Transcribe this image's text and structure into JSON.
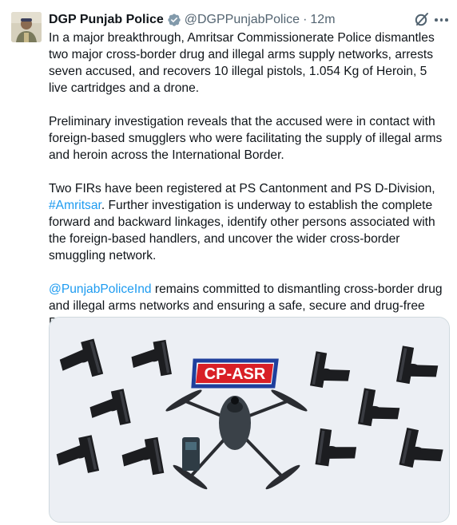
{
  "tweet": {
    "author_name": "DGP Punjab Police",
    "handle": "@DGPPunjabPolice",
    "separator": "·",
    "time": "12m",
    "paragraphs": {
      "p1": "In a major breakthrough, Amritsar Commissionerate Police dismantles two major cross-border drug and illegal arms supply networks, arrests seven accused, and recovers 10 illegal pistols, 1.054 Kg of Heroin, 5 live cartridges and a drone.",
      "p2": "Preliminary investigation reveals that the accused were in contact with foreign-based smugglers who were facilitating the supply of illegal arms and heroin across the International Border.",
      "p3_a": "Two FIRs have been registered at PS Cantonment and PS D-Division, ",
      "p3_hashtag": "#Amritsar",
      "p3_b": ". Further investigation is underway to establish the complete forward and backward linkages, identify other persons associated with the foreign-based handlers, and uncover the wider cross-border smuggling network.",
      "p4_mention": "@PunjabPoliceInd",
      "p4_b": " remains committed to dismantling cross-border drug and illegal arms networks and ensuring a safe, secure and drug-free Punjab."
    },
    "media": {
      "banner_text": "CP-ASR"
    }
  },
  "icons": {
    "verified": "verified-badge-icon",
    "grok": "grok-icon",
    "more": "more-options-icon"
  },
  "colors": {
    "text": "#0f1419",
    "secondary": "#536471",
    "link": "#1d9bf0",
    "banner_red": "#d81f26",
    "banner_blue": "#1f3f9c"
  }
}
